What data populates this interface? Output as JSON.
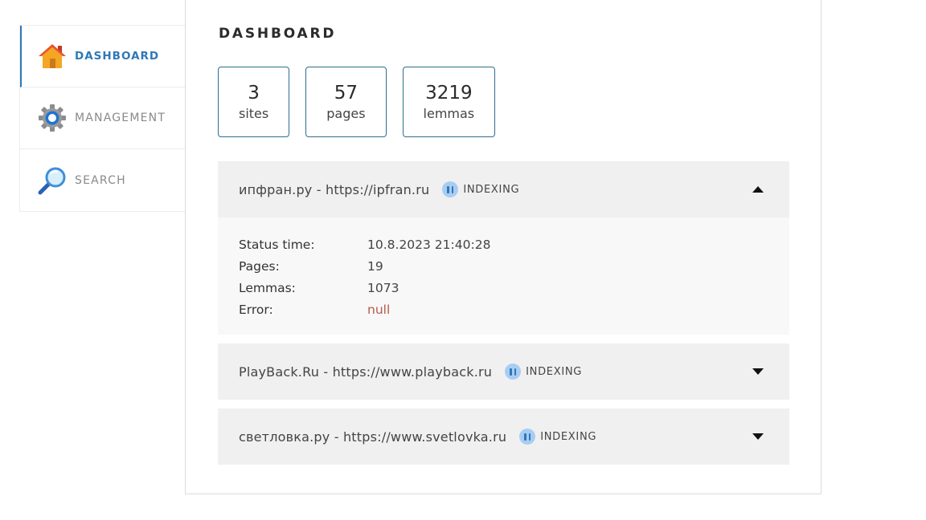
{
  "sidebar": {
    "items": [
      {
        "label": "DASHBOARD",
        "icon": "house-icon",
        "active": true
      },
      {
        "label": "MANAGEMENT",
        "icon": "gear-icon",
        "active": false
      },
      {
        "label": "SEARCH",
        "icon": "magnifier-icon",
        "active": false
      }
    ]
  },
  "main": {
    "title": "DASHBOARD",
    "stats": [
      {
        "value": "3",
        "label": "sites"
      },
      {
        "value": "57",
        "label": "pages"
      },
      {
        "value": "3219",
        "label": "lemmas"
      }
    ],
    "sites": [
      {
        "title": "ипфран.ру - https://ipfran.ru",
        "status": "INDEXING",
        "expanded": true,
        "details": {
          "status_time_label": "Status time:",
          "status_time": "10.8.2023 21:40:28",
          "pages_label": "Pages:",
          "pages": "19",
          "lemmas_label": "Lemmas:",
          "lemmas": "1073",
          "error_label": "Error:",
          "error": "null"
        }
      },
      {
        "title": "PlayBack.Ru - https://www.playback.ru",
        "status": "INDEXING",
        "expanded": false
      },
      {
        "title": "светловка.ру - https://www.svetlovka.ru",
        "status": "INDEXING",
        "expanded": false
      }
    ]
  },
  "colors": {
    "accent": "#2f78b7",
    "stat_border": "#2f6d8f",
    "error": "#b35a4a",
    "status_icon_bg": "#a8cdf3"
  }
}
